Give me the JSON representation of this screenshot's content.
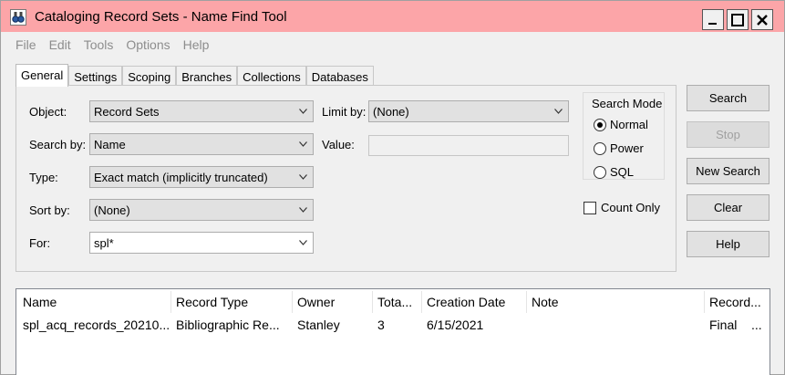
{
  "window": {
    "title": "Cataloging Record Sets - Name Find Tool",
    "titlebar_color": "#fca5a8",
    "icon": "binoculars-icon",
    "controls": {
      "minimize": "_",
      "maximize": "☐",
      "close": "✕"
    }
  },
  "menu": [
    "File",
    "Edit",
    "Tools",
    "Options",
    "Help"
  ],
  "tabs": [
    "General",
    "Settings",
    "Scoping",
    "Branches",
    "Collections",
    "Databases"
  ],
  "form": {
    "object_label": "Object:",
    "object_value": "Record Sets",
    "search_by_label": "Search by:",
    "search_by_value": "Name",
    "type_label": "Type:",
    "type_value": "Exact match (implicitly truncated)",
    "sort_by_label": "Sort by:",
    "sort_by_value": "(None)",
    "for_label": "For:",
    "for_value": "spl*",
    "limit_by_label": "Limit by:",
    "limit_by_value": "(None)",
    "value_label": "Value:",
    "value_value": ""
  },
  "search_mode": {
    "title": "Search Mode",
    "options": [
      "Normal",
      "Power",
      "SQL"
    ],
    "selected": "Normal"
  },
  "count_only": {
    "label": "Count Only",
    "checked": false
  },
  "buttons": {
    "search": "Search",
    "stop": "Stop",
    "new_search": "New Search",
    "clear": "Clear",
    "help": "Help"
  },
  "results": {
    "columns": [
      "Name",
      "Record Type",
      "Owner",
      "Tota...",
      "Creation Date",
      "Note",
      "Record..."
    ],
    "rows": [
      [
        "spl_acq_records_20210...",
        "Bibliographic Re...",
        "Stanley",
        "3",
        "6/15/2021",
        "",
        "Final",
        "..."
      ]
    ]
  }
}
